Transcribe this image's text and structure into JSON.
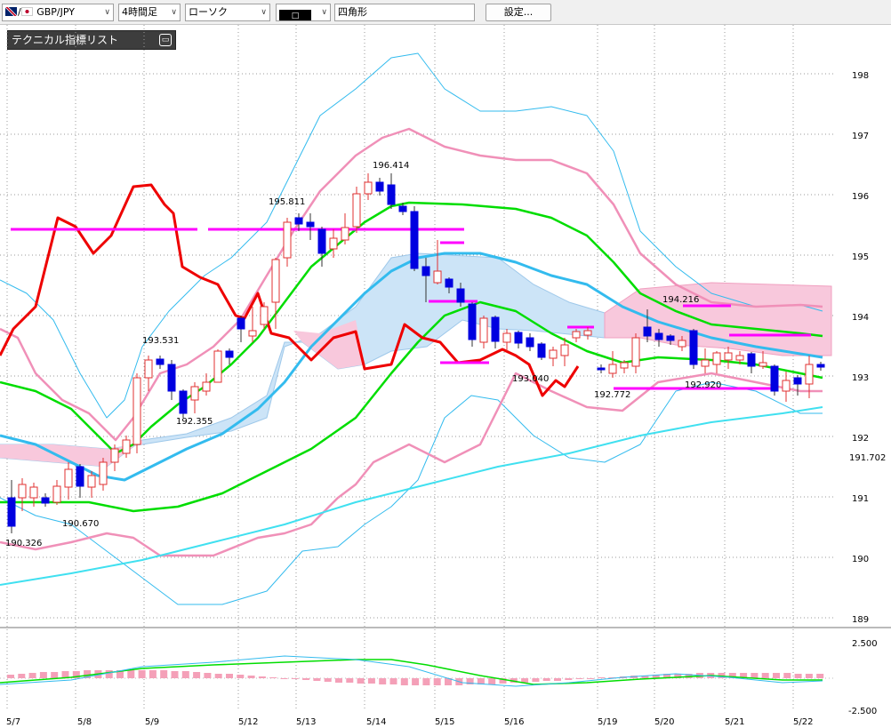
{
  "toolbar": {
    "symbol": "GBP/JPY",
    "timeframe": "4時間足",
    "chart_style": "ローソク",
    "color_chip": "□",
    "shape": "四角形",
    "settings": "設定..."
  },
  "indicator_panel": {
    "title": "テクニカル指標リスト"
  },
  "chart_data": {
    "type": "candlestick",
    "y_ticks": [
      "198",
      "197",
      "196",
      "195",
      "194",
      "193",
      "192",
      "191",
      "190",
      "189"
    ],
    "ylim": [
      188.7,
      198.3
    ],
    "current_price": "191.702",
    "x_labels": [
      "5/7",
      "5/8",
      "5/9",
      "5/12",
      "5/13",
      "5/14",
      "5/15",
      "5/16",
      "5/19",
      "5/20",
      "5/21",
      "5/22"
    ],
    "annotations": [
      "190.326",
      "190.670",
      "193.531",
      "192.355",
      "195.811",
      "196.414",
      "193.040",
      "192.772",
      "194.216",
      "192.920"
    ],
    "macd_ticks": [
      "2.500",
      "-2.500"
    ],
    "colors": {
      "up": "#e03030",
      "down": "#0000e0",
      "pink": "#f090b8",
      "magenta": "#ff00ff",
      "green": "#00dd00",
      "sky": "#33bbee",
      "cyan": "#40e0f0",
      "red": "#ee0000"
    }
  }
}
